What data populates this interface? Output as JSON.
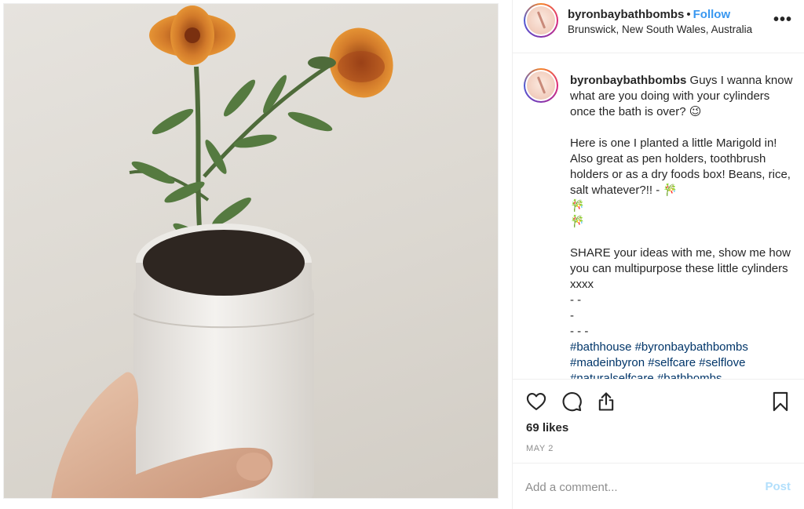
{
  "post": {
    "image_alt": "photo of a marigold planted in a white cylinder container held by a hand",
    "author": {
      "username": "byronbaybathbombs",
      "location": "Brunswick, New South Wales, Australia",
      "follow_label": "Follow",
      "separator": "•"
    },
    "more_icon": "more-horizontal-icon",
    "caption": {
      "username": "byronbaybathbombs",
      "text": " Guys I wanna know what are you doing with your cylinders once the bath is over? 😉\n\nHere is one I planted a little Marigold in! Also great as pen holders, toothbrush holders or as a dry foods box! Beans, rice, salt whatever?!! - 🎋\n🎋\n🎋\n\nSHARE your ideas with me, show me how you can multipurpose these little cylinders xxxx\n- -\n-\n- - -\n",
      "hashtags": "#bathhouse #byronbaybathbombs #madeinbyron #selfcare #selflove #naturalselfcare #bathbombs"
    },
    "actions": {
      "like_icon": "heart-icon",
      "comment_icon": "comment-icon",
      "share_icon": "share-icon",
      "save_icon": "bookmark-icon"
    },
    "likes": "69 likes",
    "date": "MAY 2",
    "comment": {
      "placeholder": "Add a comment...",
      "post_label": "Post"
    },
    "colors": {
      "link": "#3897f0",
      "hashtag": "#003569",
      "post_disabled": "#b2dffc",
      "muted": "#8e8e8e"
    }
  }
}
